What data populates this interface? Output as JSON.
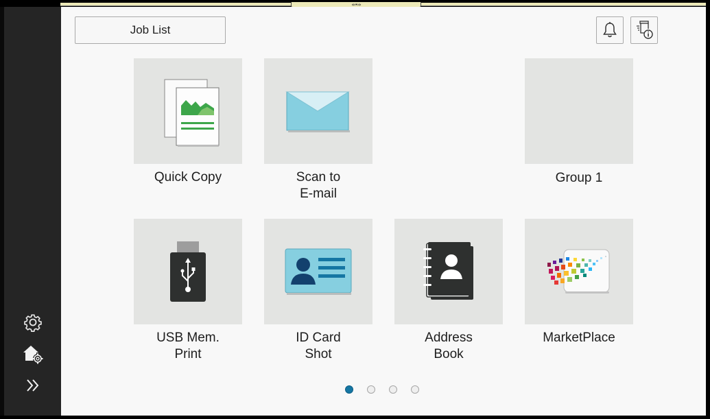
{
  "header": {
    "job_list_label": "Job List",
    "right_icons": [
      "bell-icon",
      "device-info-icon"
    ]
  },
  "tiles": [
    {
      "label": "Quick Copy",
      "icon": "copy-icon"
    },
    {
      "label": "Scan to\nE-mail",
      "icon": "envelope-icon"
    },
    {
      "label": "Group 1",
      "icon": "group-folder"
    },
    {
      "label": "USB Mem.\nPrint",
      "icon": "usb-icon"
    },
    {
      "label": "ID Card\nShot",
      "icon": "id-card-icon"
    },
    {
      "label": "Address\nBook",
      "icon": "address-book-icon"
    },
    {
      "label": "MarketPlace",
      "icon": "marketplace-icon"
    }
  ],
  "sidebar": {
    "icons": [
      "settings-icon",
      "home-settings-icon",
      "expand-icon"
    ]
  },
  "pagination": {
    "pages": 4,
    "current": 1
  },
  "colors": {
    "sidebar_bg": "#252525",
    "tile_bg": "#e3e4e2",
    "active_dot": "#1576a3",
    "envelope": "#86cfe0",
    "green": "#3da64a"
  }
}
